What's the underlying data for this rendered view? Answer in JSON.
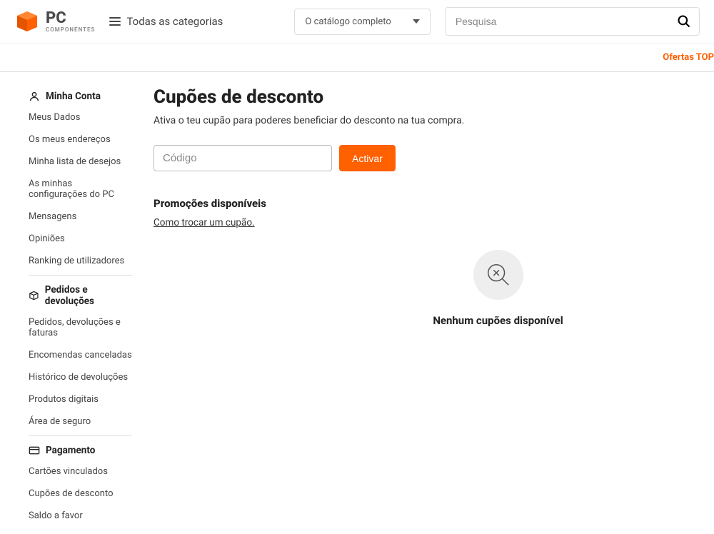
{
  "header": {
    "logo_text": "PC",
    "logo_sub": "COMPONENTES",
    "categories_label": "Todas as categorias",
    "catalog_select": "O catálogo completo",
    "search_placeholder": "Pesquisa"
  },
  "subheader": {
    "offers_label": "Ofertas TOP"
  },
  "sidebar": {
    "sections": [
      {
        "title": "Minha Conta",
        "icon": "user",
        "items": [
          "Meus Dados",
          "Os meus endereços",
          "Minha lista de desejos",
          "As minhas configurações do PC",
          "Mensagens",
          "Opiniões",
          "Ranking de utilizadores"
        ]
      },
      {
        "title": "Pedidos e devoluções",
        "icon": "box",
        "items": [
          "Pedidos, devoluções e faturas",
          "Encomendas canceladas",
          "Histórico de devoluções",
          "Produtos digitais",
          "Área de seguro"
        ]
      },
      {
        "title": "Pagamento",
        "icon": "card",
        "items": [
          "Cartões vinculados",
          "Cupões de desconto",
          "Saldo a favor"
        ]
      }
    ]
  },
  "main": {
    "title": "Cupões de desconto",
    "description": "Ativa o teu cupão para poderes beneficiar do desconto na tua compra.",
    "coupon_placeholder": "Código",
    "activate_label": "Activar",
    "promos_title": "Promoções disponíveis",
    "how_to_link": "Como trocar um cupão.",
    "empty_label": "Nenhum cupões disponível"
  }
}
